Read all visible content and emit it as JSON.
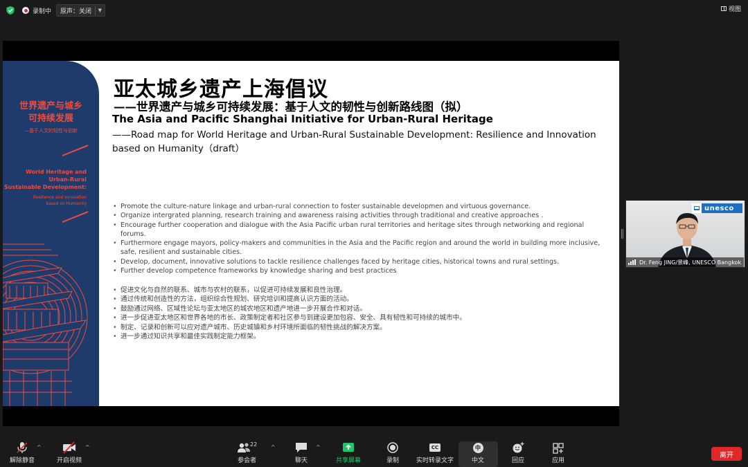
{
  "topbar": {
    "recording_label": "录制中",
    "audio_label": "原声：关闭",
    "view_label": "视图"
  },
  "slide": {
    "left_panel": {
      "cn_title_line1": "世界遗产与城乡",
      "cn_title_line2": "可持续发展",
      "cn_subtitle": "—基于人文的韧性与创新",
      "en_title_line1": "World Heritage and",
      "en_title_line2": "Urban-Rural",
      "en_title_line3": "Sustainable Development:",
      "en_subtitle_line1": "Resilience and Innovation",
      "en_subtitle_line2": "based on Humanity"
    },
    "title_cn": "亚太城乡遗产上海倡议",
    "subtitle_cn": "——世界遗产与城乡可持续发展：基于人文的韧性与创新路线图（拟）",
    "title_en": "The Asia and Pacific Shanghai Initiative for Urban-Rural Heritage",
    "subtitle_en": "——Road map for World Heritage and Urban-Rural Sustainable Development: Resilience and Innovation based on Humanity（draft）",
    "bullets_en": [
      "Promote the culture-nature linkage and urban-rural connection to foster sustainable developmen and virtuous governance.",
      "Organize intergrated planning, research training and awareness raising activities through traditional and creative approaches .",
      "Encourage further cooperation and dialogue with the Asia Pacific urban rural territories and heritage sites through networking and regional forums.",
      "Furthermore engage mayors, policy-makers and communities in the Asia and the Pacific region and around the world in building more inclusive, safe, resilient and sustainable cities.",
      "Develop, document, innovative solutions to tackle resilience challenges faced by heritage cities, historical towns and rural settings.",
      "Further develop competence frameworks by knowledge sharing and best practices"
    ],
    "bullets_cn": [
      "促进文化与自然的联系、城市与农村的联系，以促进可持续发展和良性治理。",
      "通过传统和创造性的方法，组织综合性规划、研究培训和提高认识方面的活动。",
      "鼓励通过网络、区域性论坛与亚太地区的城农地区和遗产地进一步开展合作和对话。",
      "进一步促进亚太地区和世界各地的市长、政策制定者和社区参与到建设更加包容、安全、具有韧性和可持续的城市中。",
      "制定、记录和创新可以应对遗产城市、历史城镇和乡村环境所面临的韧性挑战的解决方案。",
      "进一步通过知识共享和最佳实践制定能力框架。"
    ]
  },
  "participant": {
    "name": "Dr. Feng JING/景峰, UNESCO Bangkok",
    "logo_text": "unesco"
  },
  "toolbar": {
    "unmute": "解除静音",
    "start_video": "开启视频",
    "participants": "参会者",
    "participants_count": "22",
    "chat": "聊天",
    "share_screen": "共享屏幕",
    "record": "录制",
    "transcript": "实时转录文字",
    "language": "中文",
    "language_badge": "中",
    "reactions": "回应",
    "apps": "应用",
    "leave": "离开",
    "cc_badge": "CC"
  },
  "colors": {
    "accent_red": "#e02828",
    "panel_blue": "#1f3b6b",
    "panel_red": "#f04b3c",
    "share_green": "#23c36b",
    "unesco_blue": "#1d6fc0"
  }
}
